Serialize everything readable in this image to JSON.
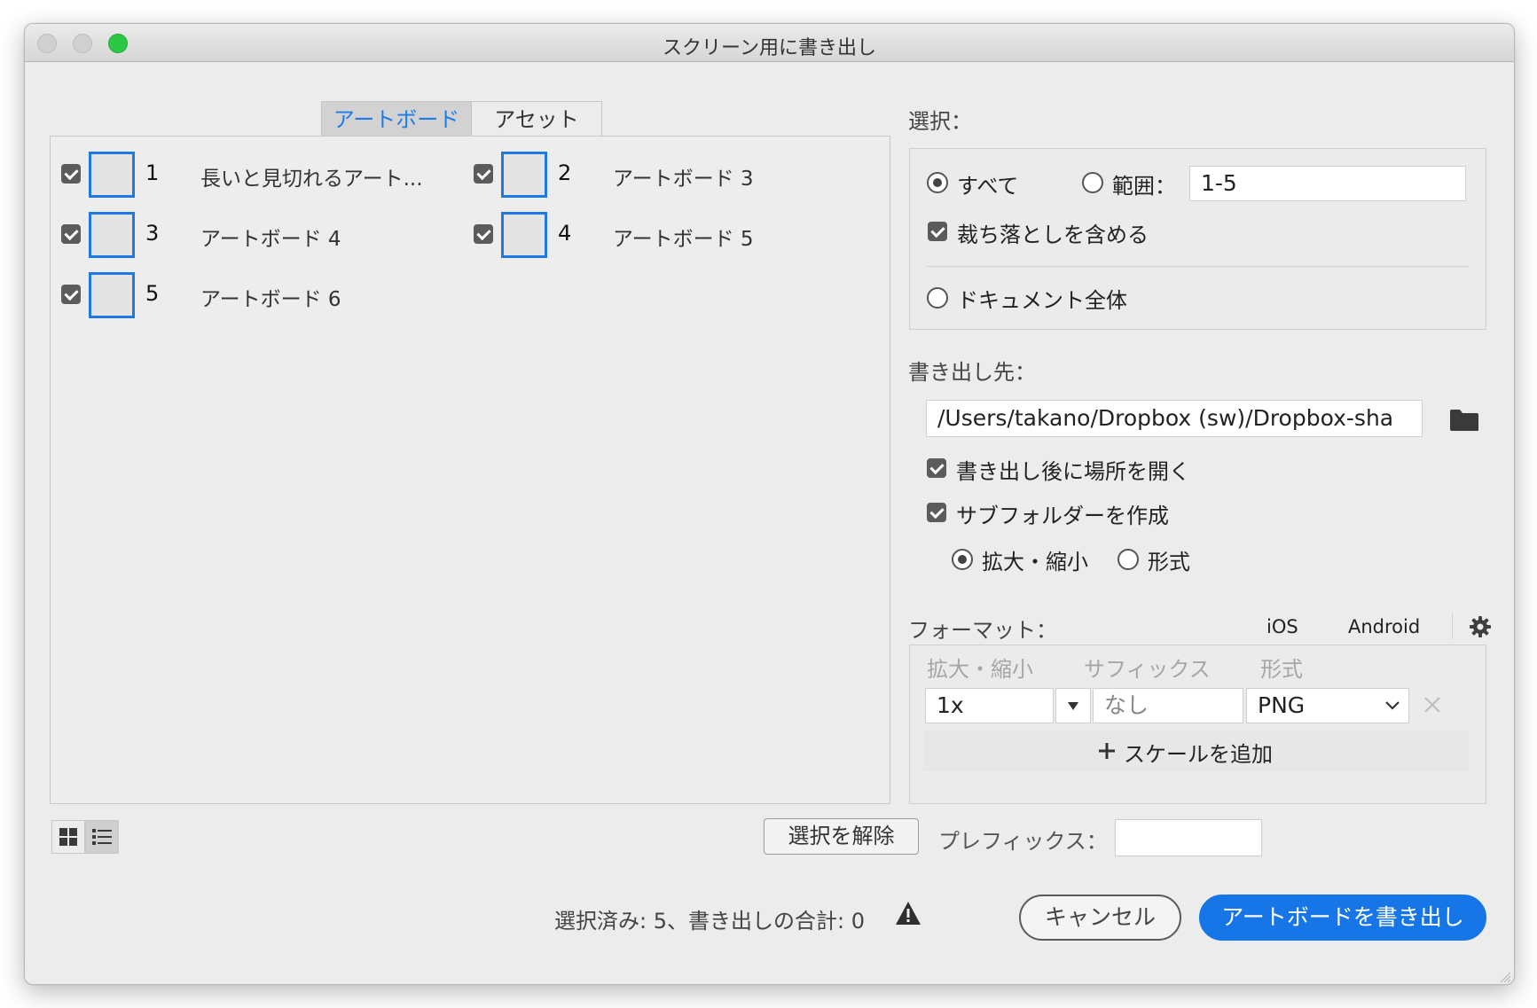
{
  "window": {
    "title": "スクリーン用に書き出し"
  },
  "tabs": [
    {
      "label": "アートボード",
      "active": true
    },
    {
      "label": "アセット",
      "active": false
    }
  ],
  "artboards": [
    {
      "number": "1",
      "name": "長いと見切れるアート...",
      "checked": true
    },
    {
      "number": "2",
      "name": "アートボード 3",
      "checked": true
    },
    {
      "number": "3",
      "name": "アートボード 4",
      "checked": true
    },
    {
      "number": "4",
      "name": "アートボード 5",
      "checked": true
    },
    {
      "number": "5",
      "name": "アートボード 6",
      "checked": true
    }
  ],
  "select": {
    "label": "選択：",
    "all_label": "すべて",
    "range_label": "範囲：",
    "range_value": "1-5",
    "selected_option": "all",
    "include_bleed_label": "裁ち落としを含める",
    "include_bleed_checked": true,
    "whole_document_label": "ドキュメント全体"
  },
  "export_to": {
    "label": "書き出し先：",
    "path": "/Users/takano/Dropbox (sw)/Dropbox-sha",
    "open_after_label": "書き出し後に場所を開く",
    "open_after_checked": true,
    "create_subfolders_label": "サブフォルダーを作成",
    "create_subfolders_checked": true,
    "subfolder_by_scale_label": "拡大・縮小",
    "subfolder_by_format_label": "形式",
    "subfolder_selected": "scale"
  },
  "formats": {
    "label": "フォーマット：",
    "ios_label": "iOS",
    "android_label": "Android",
    "columns": [
      "拡大・縮小",
      "サフィックス",
      "形式"
    ],
    "rows": [
      {
        "scale": "1x",
        "suffix_placeholder": "なし",
        "format": "PNG"
      }
    ],
    "add_scale_label": "スケールを追加"
  },
  "footer": {
    "deselect_label": "選択を解除",
    "prefix_label": "プレフィックス：",
    "prefix_value": "",
    "status_text": "選択済み: 5、書き出しの合計: 0",
    "cancel_label": "キャンセル",
    "export_label": "アートボードを書き出し"
  },
  "colors": {
    "accent": "#1776e7",
    "traffic_green": "#2ac845",
    "window_bg": "#ececec"
  }
}
